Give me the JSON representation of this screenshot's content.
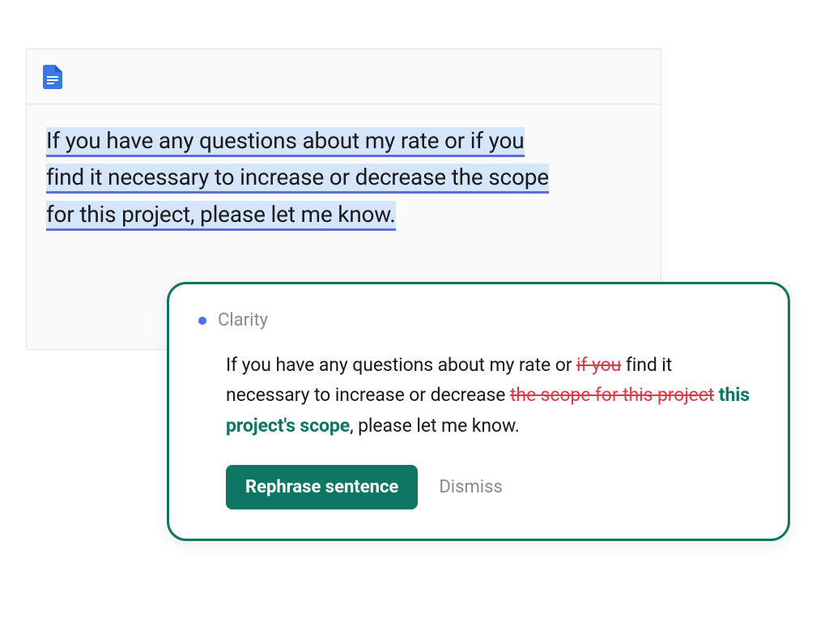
{
  "editor": {
    "highlighted_line1": "If you have any questions about my rate or if you",
    "highlighted_line2": "find it necessary to increase or decrease the scope",
    "highlighted_line3": "for this project, please let me know."
  },
  "suggestion": {
    "category": "Clarity",
    "text_parts": {
      "p1": "If you have any questions about my rate or ",
      "strike1": "if you",
      "p2": " find it necessary to increase or decrease ",
      "strike2": "the scope for this project",
      "insert1": " this project's scope",
      "p3": ", please let me know."
    },
    "actions": {
      "primary": "Rephrase sentence",
      "secondary": "Dismiss"
    }
  },
  "colors": {
    "accent": "#0d7764",
    "highlight_bg": "#d5e5fb",
    "highlight_underline": "#5a6fd8",
    "strike": "#e0394a",
    "dot": "#4c6ef5"
  }
}
